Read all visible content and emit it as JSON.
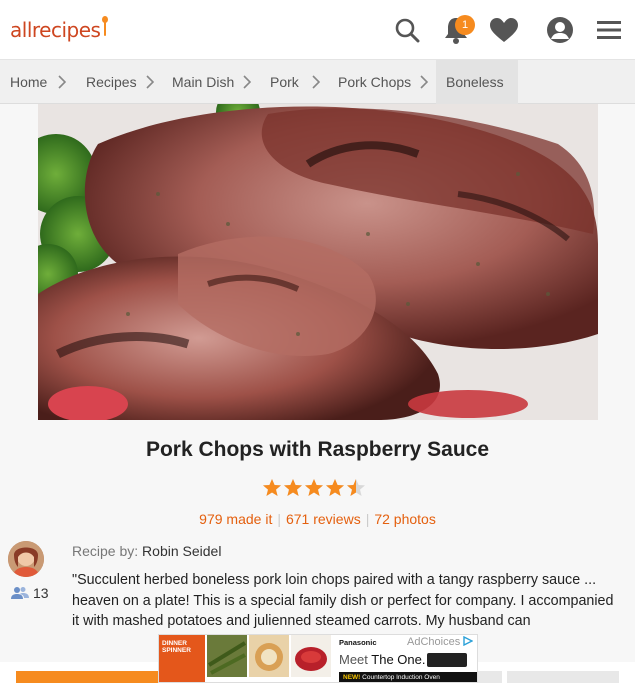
{
  "header": {
    "logo_text": "allrecipes",
    "notification_count": "1",
    "icons": [
      "search-icon",
      "bell-icon",
      "heart-icon",
      "profile-icon",
      "menu-icon"
    ]
  },
  "breadcrumb": [
    "Home",
    "Recipes",
    "Main Dish",
    "Pork",
    "Pork Chops",
    "Boneless"
  ],
  "recipe": {
    "title": "Pork Chops with Raspberry Sauce",
    "rating": 4.5,
    "made_it": "979 made it",
    "reviews": "671 reviews",
    "photos": "72 photos",
    "recipe_by_label": "Recipe by:",
    "author": "Robin Seidel",
    "followers": "13",
    "description": "\"Succulent herbed boneless pork loin chops paired with a tangy raspberry sauce ... heaven on a plate! This is a special family dish or perfect for company. I accompanied it with mashed potatoes and julienned steamed carrots. My husband can"
  },
  "ad": {
    "spinner_label": "DINNER SPINNER",
    "brand": "Panasonic",
    "ad_choices": "AdChoices",
    "headline_prefix": "Meet",
    "headline": "The One.",
    "strip_new": "NEW!",
    "strip_text": "Countertop Induction Oven"
  },
  "colors": {
    "brand_orange": "#f68b1f",
    "logo_red": "#ce4620",
    "link_orange": "#e4600f"
  }
}
